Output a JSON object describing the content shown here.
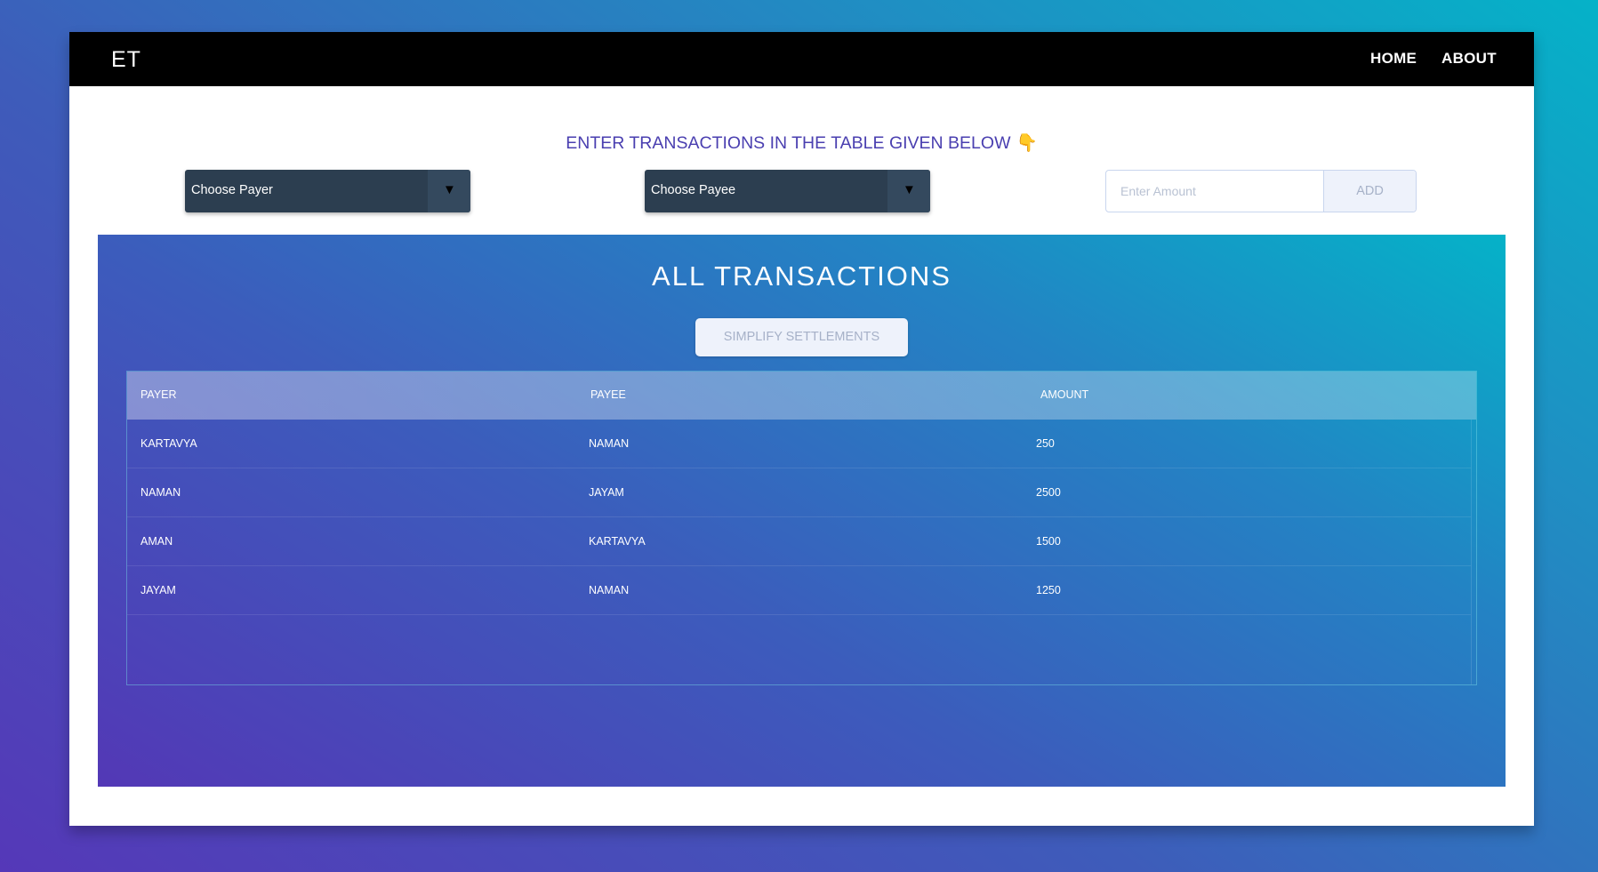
{
  "navbar": {
    "brand": "ET",
    "links": [
      "HOME",
      "ABOUT"
    ]
  },
  "form": {
    "heading": "ENTER TRANSACTIONS IN THE TABLE GIVEN BELOW",
    "heading_icon": "👇",
    "payer_select": "Choose Payer",
    "payee_select": "Choose Payee",
    "amount_placeholder": "Enter Amount",
    "add_label": "ADD"
  },
  "transactions": {
    "title": "ALL TRANSACTIONS",
    "simplify_label": "SIMPLIFY SETTLEMENTS",
    "columns": [
      "PAYER",
      "PAYEE",
      "AMOUNT"
    ],
    "rows": [
      [
        "KARTAVYA",
        "NAMAN",
        "250"
      ],
      [
        "NAMAN",
        "JAYAM",
        "2500"
      ],
      [
        "AMAN",
        "KARTAVYA",
        "1500"
      ],
      [
        "JAYAM",
        "NAMAN",
        "1250"
      ]
    ]
  },
  "colors": {
    "navbar_bg": "#000000",
    "heading_text": "#4a3fb0",
    "select_bg": "#2c3e50",
    "gradient_start": "#5338b6",
    "gradient_end": "#05b2c8"
  }
}
